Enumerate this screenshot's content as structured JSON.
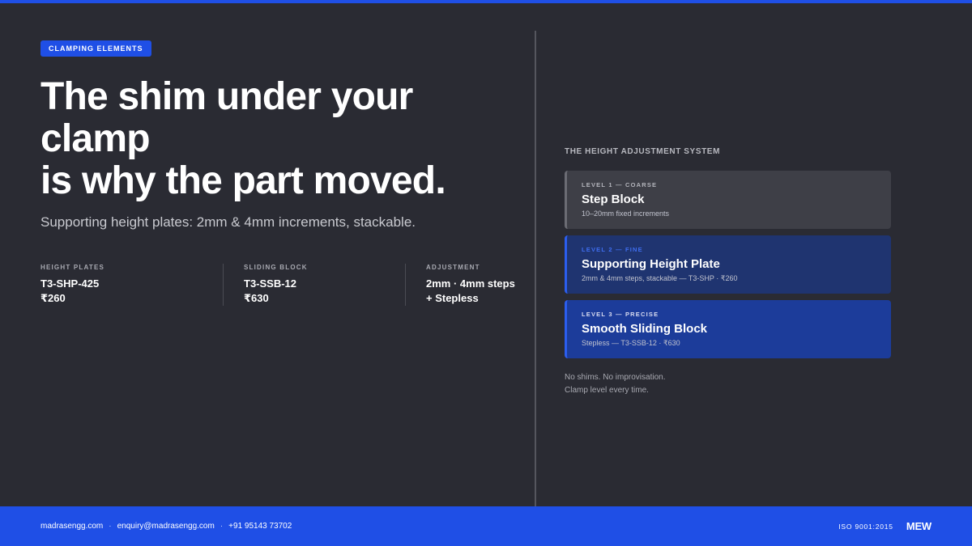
{
  "colors": {
    "background": "#2a2b33",
    "accent": "#1f4fe6",
    "fine_panel": "#1f3470",
    "precise_panel": "#1c3c9a",
    "coarse_panel": "#3e3f47"
  },
  "hero": {
    "badge": "CLAMPING ELEMENTS",
    "headline_lines": [
      "The shim under your",
      "clamp",
      "is why the part moved."
    ],
    "subhead": "Supporting height plates: 2mm & 4mm increments, stackable."
  },
  "specs": [
    {
      "label": "HEIGHT PLATES",
      "value_lines": [
        "T3-SHP-425",
        "₹260"
      ]
    },
    {
      "label": "SLIDING BLOCK",
      "value_lines": [
        "T3-SSB-12",
        "₹630"
      ]
    },
    {
      "label": "ADJUSTMENT",
      "value_lines": [
        "2mm · 4mm steps",
        "+ Stepless"
      ]
    }
  ],
  "system": {
    "title": "THE HEIGHT ADJUSTMENT SYSTEM",
    "levels": [
      {
        "tag": "LEVEL 1 — COARSE",
        "name": "Step Block",
        "desc": "10–20mm fixed increments"
      },
      {
        "tag": "LEVEL 2 — FINE",
        "name": "Supporting Height Plate",
        "desc": "2mm & 4mm steps, stackable — T3-SHP · ₹260"
      },
      {
        "tag": "LEVEL 3 — PRECISE",
        "name": "Smooth Sliding Block",
        "desc": "Stepless — T3-SSB-12 · ₹630"
      }
    ],
    "note_lines": [
      "No shims. No improvisation.",
      "Clamp level every time."
    ]
  },
  "footer": {
    "website": "madrasengg.com",
    "email": "enquiry@madrasengg.com",
    "phone": "+91 95143 73702",
    "separator": "·",
    "iso": "ISO 9001:2015",
    "logo": "MEW"
  }
}
